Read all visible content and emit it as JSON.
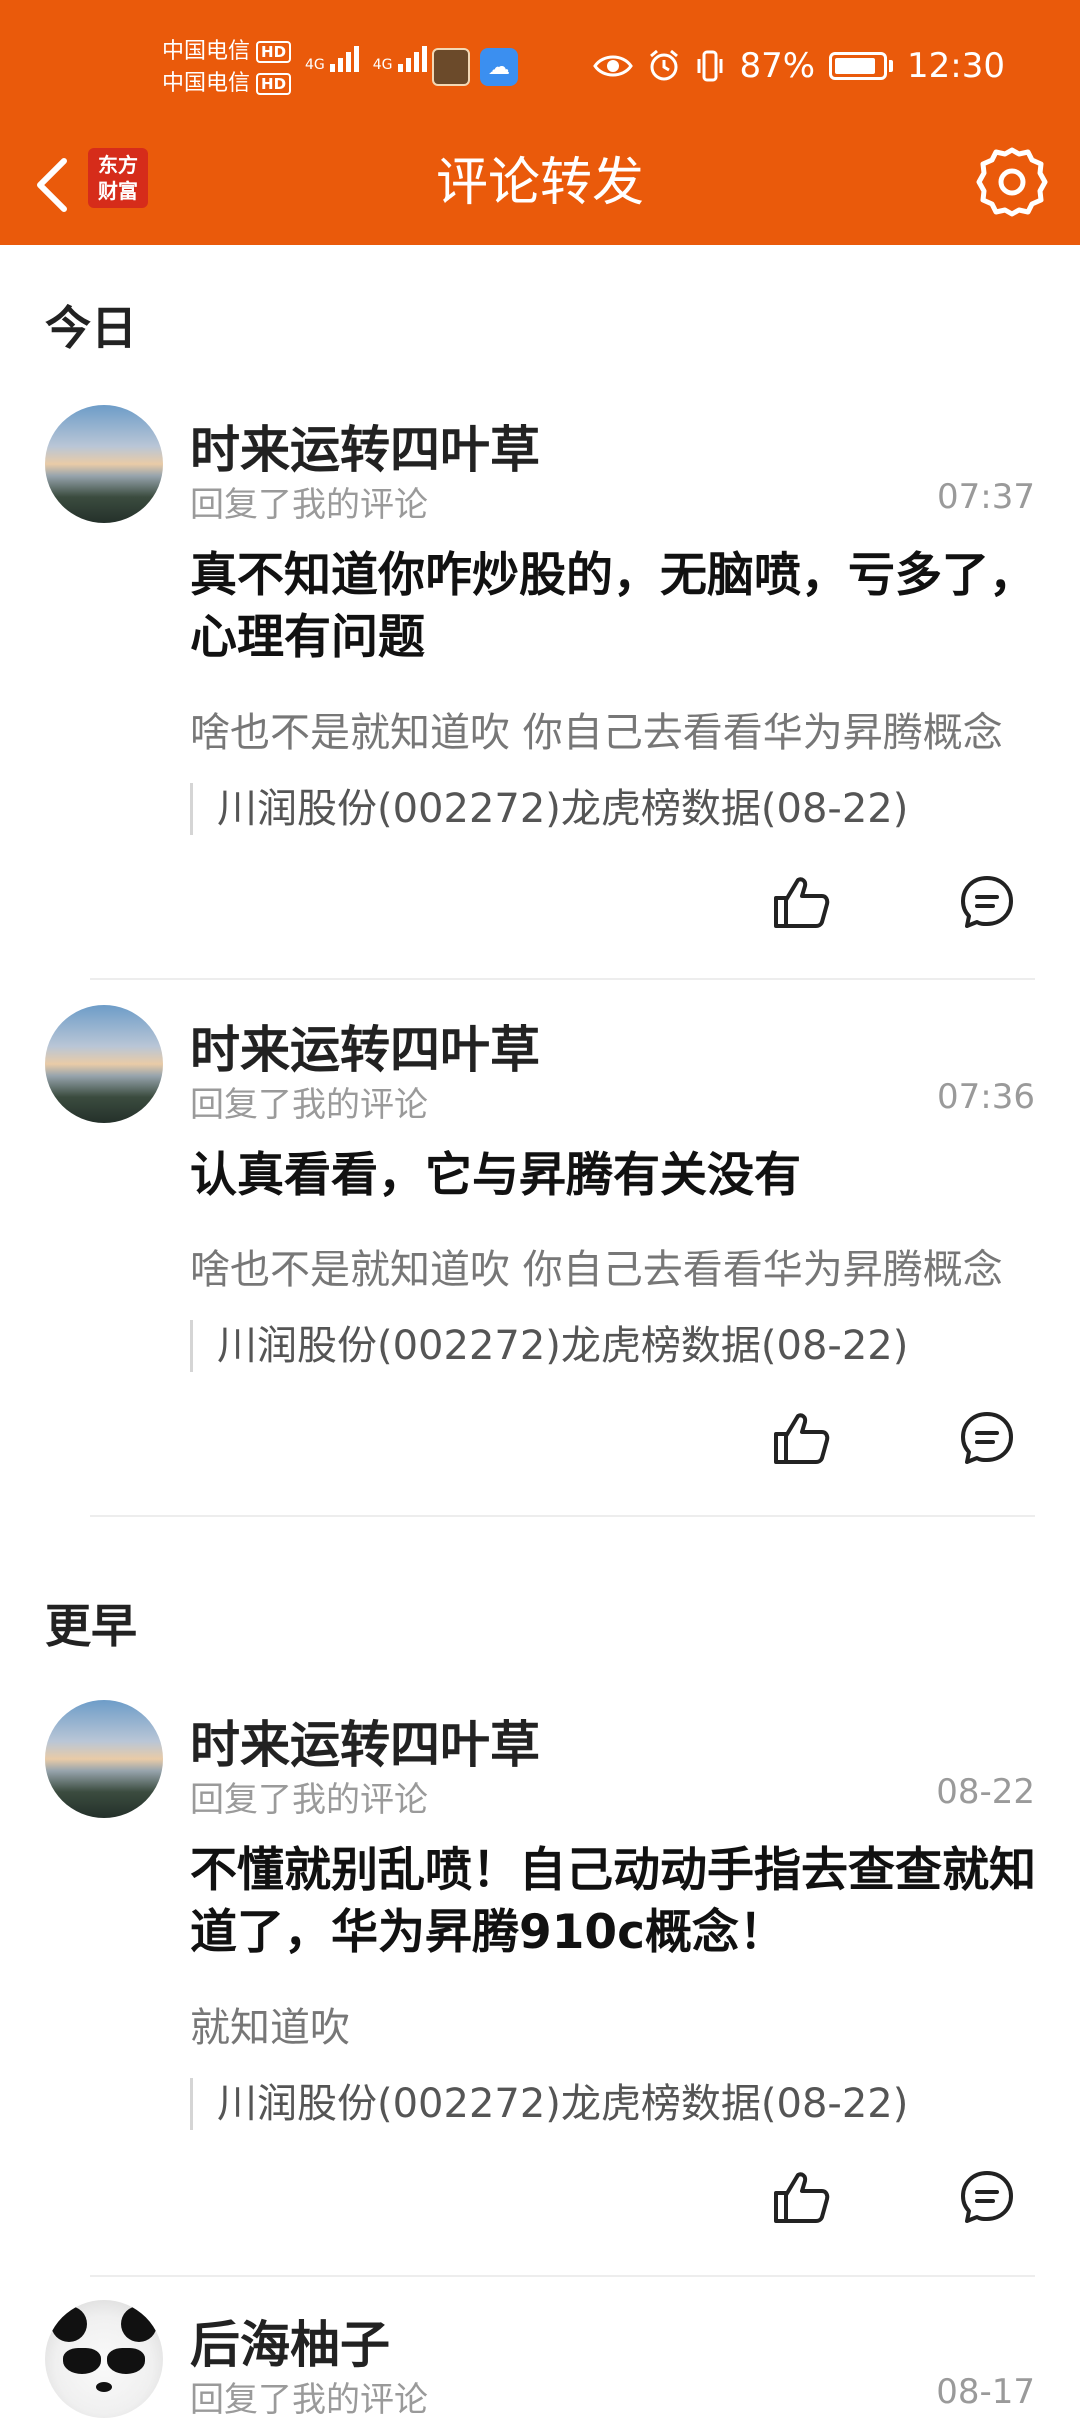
{
  "status_bar": {
    "carrier1": "中国电信",
    "carrier2": "中国电信",
    "hd": "HD",
    "net1": "4G",
    "net2": "4G",
    "battery_percent": "87%",
    "battery_level": 0.87,
    "time": "12:30",
    "icons": [
      "eye-icon",
      "alarm-icon",
      "vibrate-icon",
      "battery-icon"
    ]
  },
  "header": {
    "title": "评论转发",
    "logo_line1": "东方",
    "logo_line2": "财富",
    "accent_color": "#ea5a0b"
  },
  "sections": {
    "today": "今日",
    "earlier": "更早"
  },
  "comments": [
    {
      "user": "时来运转四叶草",
      "action": "回复了我的评论",
      "time": "07:37",
      "reply": "真不知道你咋炒股的，无脑喷，亏多了，心理有问题",
      "original": "啥也不是就知道吹 你自己去看看华为昇腾概念",
      "source": "川润股份(002272)龙虎榜数据(08-22)"
    },
    {
      "user": "时来运转四叶草",
      "action": "回复了我的评论",
      "time": "07:36",
      "reply": "认真看看，它与昇腾有关没有",
      "original": "啥也不是就知道吹 你自己去看看华为昇腾概念",
      "source": "川润股份(002272)龙虎榜数据(08-22)"
    },
    {
      "user": "时来运转四叶草",
      "action": "回复了我的评论",
      "time": "08-22",
      "reply": "不懂就别乱喷！自己动动手指去查查就知道了，华为昇腾910c概念！",
      "original": "就知道吹",
      "source": "川润股份(002272)龙虎榜数据(08-22)"
    },
    {
      "user": "后海柚子",
      "action": "回复了我的评论",
      "time": "08-17"
    }
  ]
}
